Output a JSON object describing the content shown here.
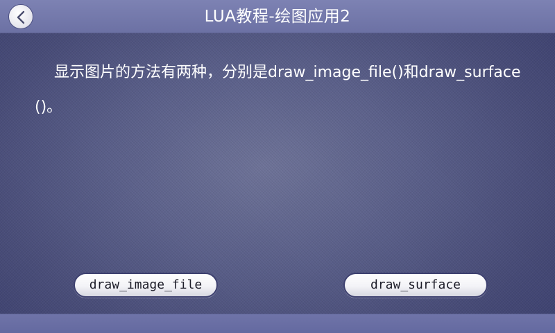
{
  "header": {
    "title": "LUA教程-绘图应用2",
    "back_icon": "chevron-left-icon"
  },
  "content": {
    "description": "显示图片的方法有两种，分别是draw_image_file()和draw_surface()。"
  },
  "buttons": {
    "draw_image_file": "draw_image_file",
    "draw_surface": "draw_surface"
  },
  "colors": {
    "title_bar": "#767bad",
    "background": "#5a5f89",
    "text": "#ffffff"
  }
}
